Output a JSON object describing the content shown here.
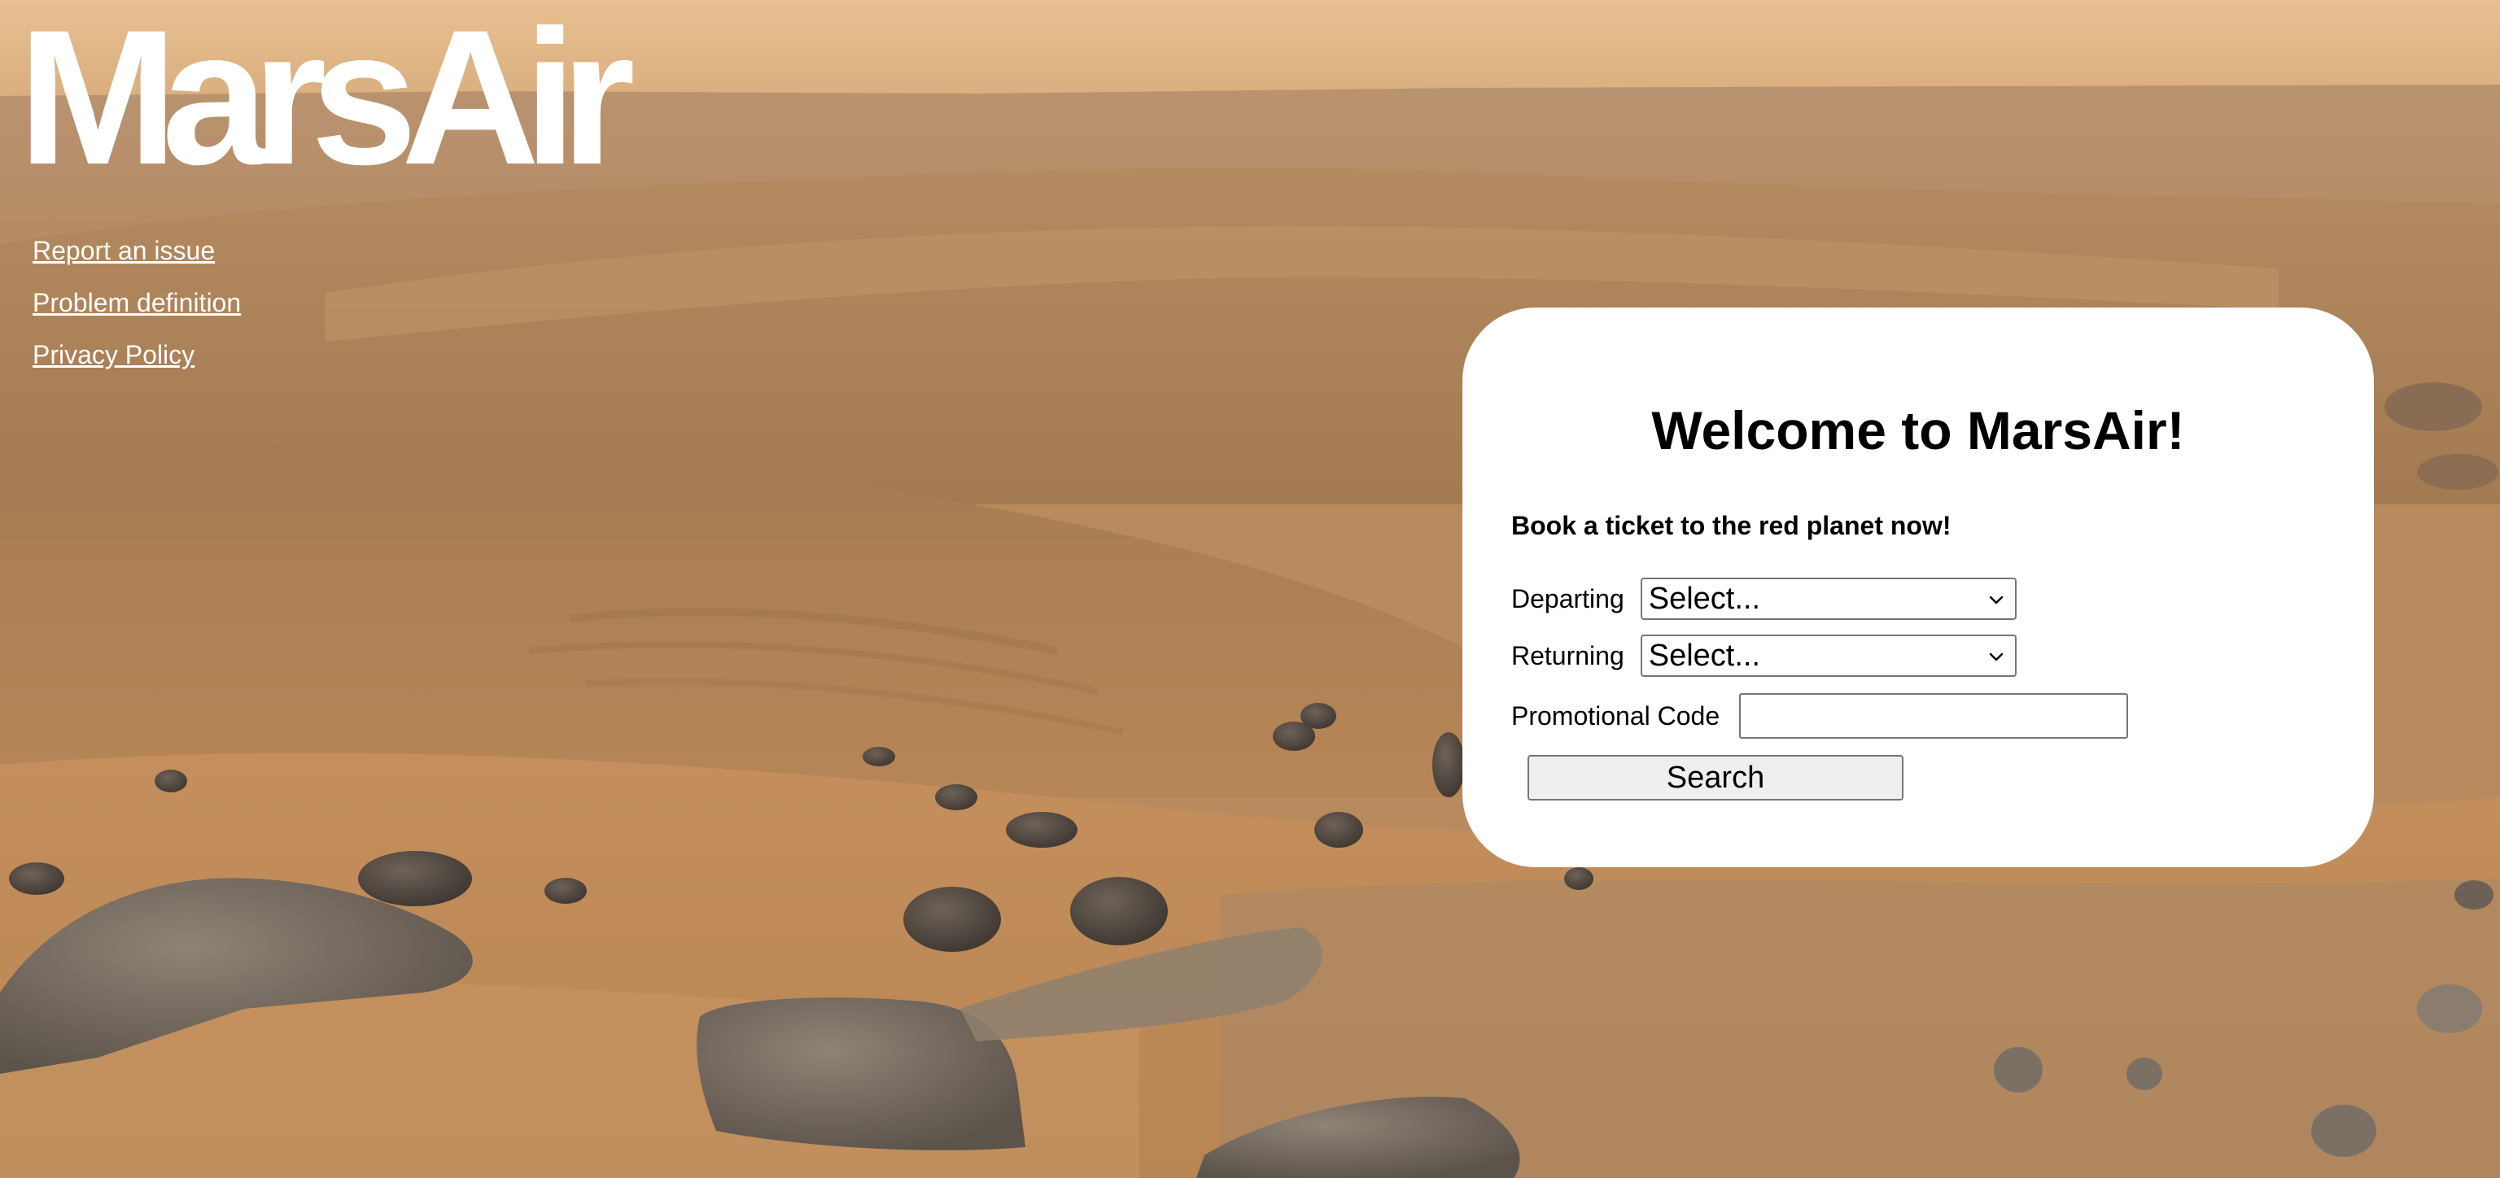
{
  "app": {
    "logo_text": "MarsAir"
  },
  "nav": {
    "links": [
      {
        "label": "Report an issue"
      },
      {
        "label": "Problem definition"
      },
      {
        "label": "Privacy Policy"
      }
    ]
  },
  "booking": {
    "heading": "Welcome to MarsAir!",
    "tagline": "Book a ticket to the red planet now!",
    "departing": {
      "label": "Departing",
      "selected": "Select..."
    },
    "returning": {
      "label": "Returning",
      "selected": "Select..."
    },
    "promo": {
      "label": "Promotional Code",
      "value": ""
    },
    "search_label": "Search"
  },
  "colors": {
    "sky": "#e6bd8c",
    "ground": "#c18e5c",
    "card_background": "#ffffff",
    "link": "#ffffff"
  }
}
